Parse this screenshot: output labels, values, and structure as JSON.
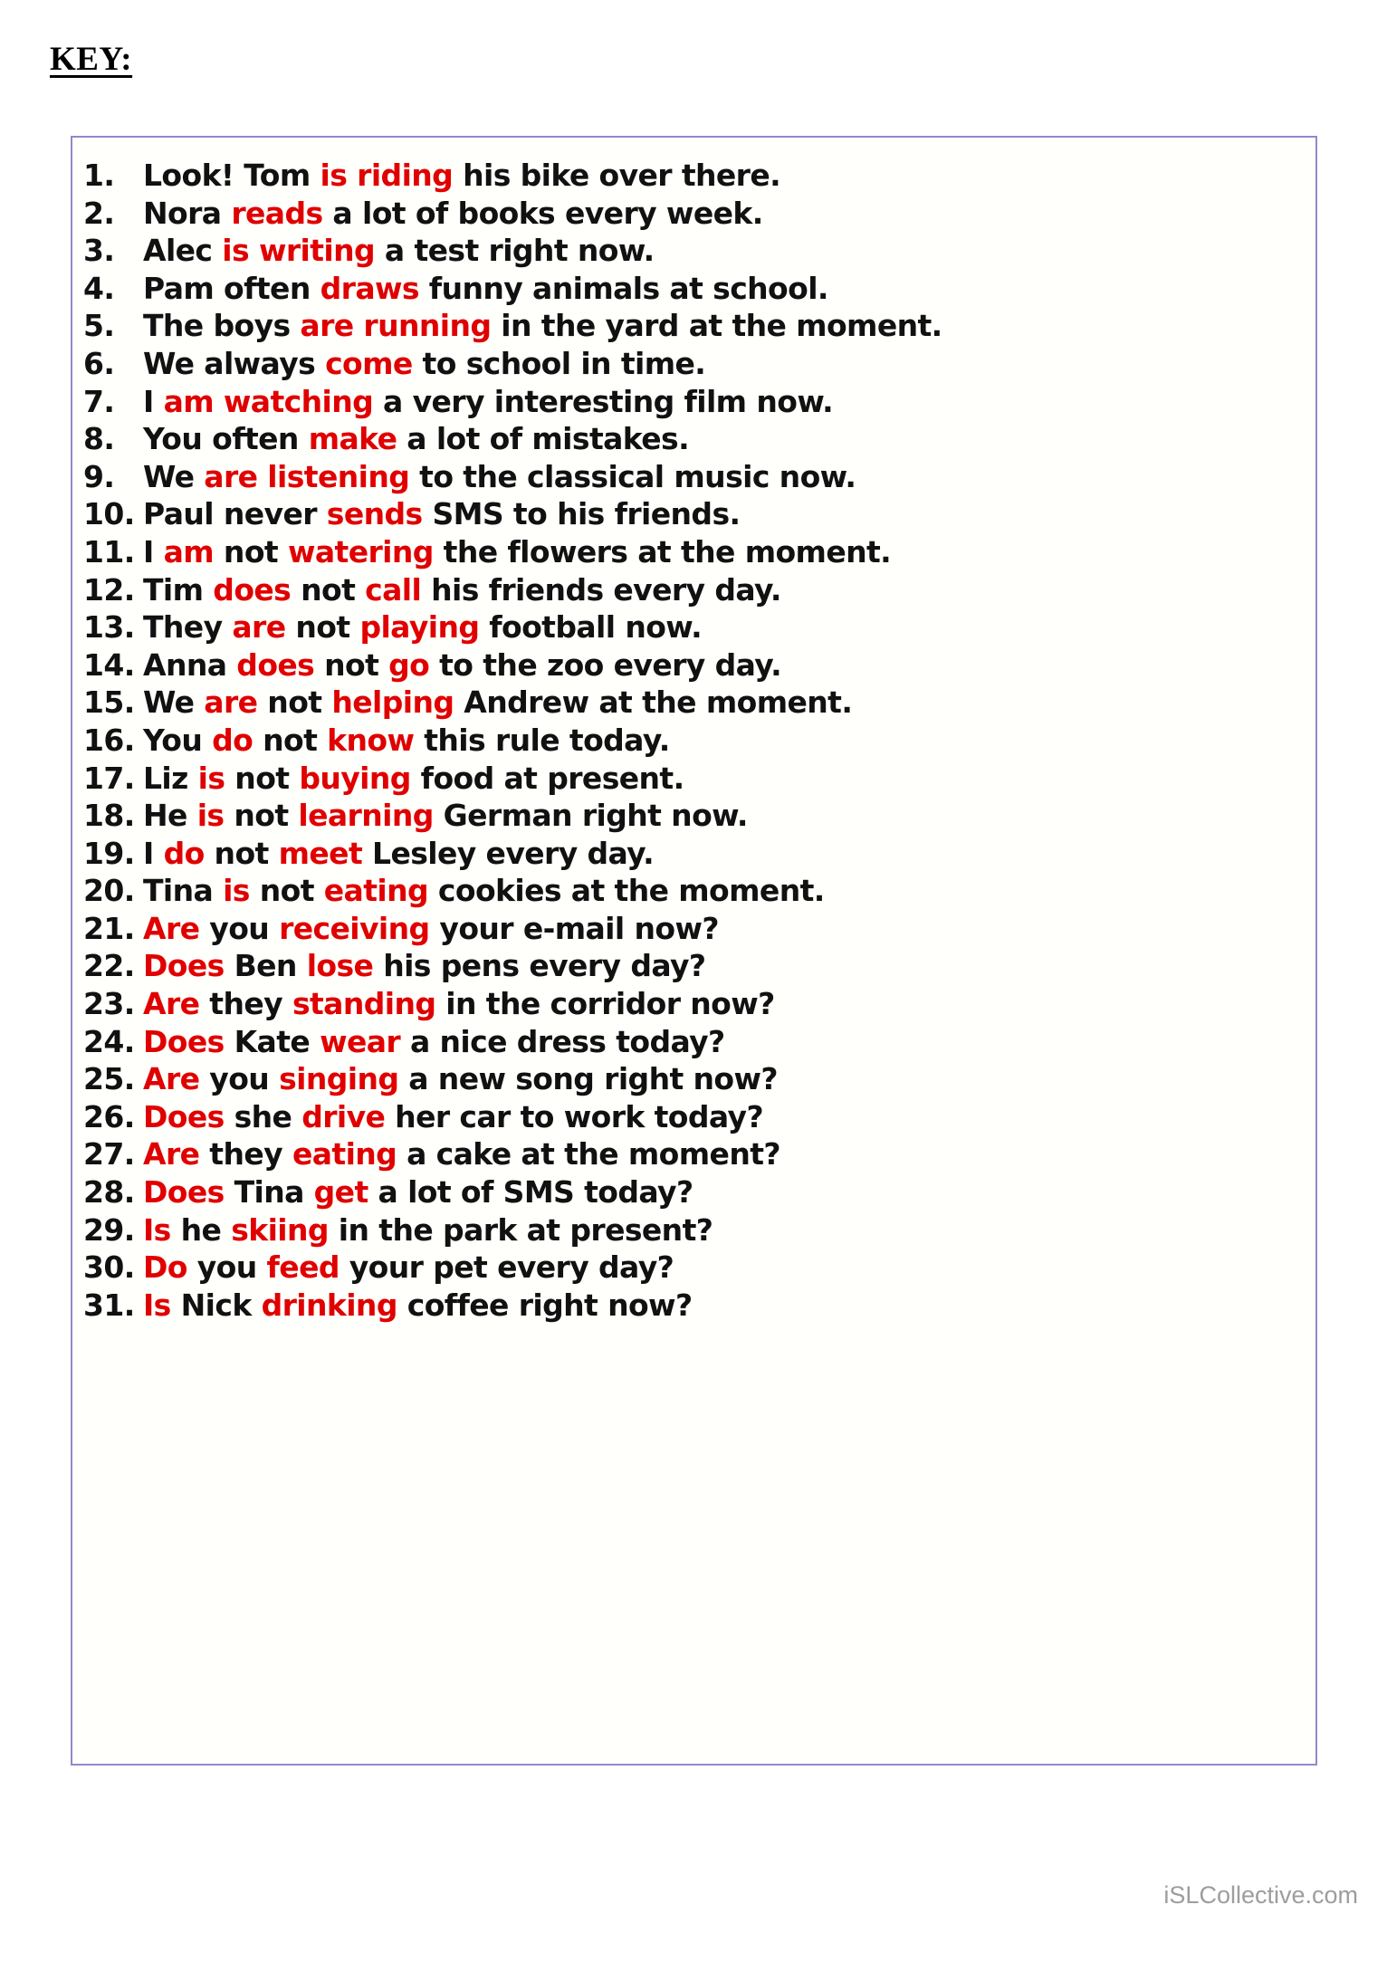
{
  "page": {
    "title": "KEY:",
    "background_color": "#ffffff",
    "box_border_color": "#8f8ac9",
    "highlight_color": "#e00000",
    "text_color": "#111111"
  },
  "watermark": {
    "text": "iSLCollective.com",
    "color": "#9d9d9d"
  },
  "answers": [
    {
      "number": "1.",
      "segments": [
        {
          "t": "Look! Tom ",
          "hl": false
        },
        {
          "t": "is riding",
          "hl": true
        },
        {
          "t": " his bike over there.",
          "hl": false
        }
      ]
    },
    {
      "number": "2.",
      "segments": [
        {
          "t": "Nora ",
          "hl": false
        },
        {
          "t": "reads",
          "hl": true
        },
        {
          "t": " a lot of books every week.",
          "hl": false
        }
      ]
    },
    {
      "number": "3.",
      "segments": [
        {
          "t": "Alec ",
          "hl": false
        },
        {
          "t": "is writing",
          "hl": true
        },
        {
          "t": " a test right now.",
          "hl": false
        }
      ]
    },
    {
      "number": "4.",
      "segments": [
        {
          "t": "Pam often ",
          "hl": false
        },
        {
          "t": "draws",
          "hl": true
        },
        {
          "t": " funny animals at school.",
          "hl": false
        }
      ]
    },
    {
      "number": "5.",
      "segments": [
        {
          "t": "The boys ",
          "hl": false
        },
        {
          "t": "are running",
          "hl": true
        },
        {
          "t": " in the yard at the moment.",
          "hl": false
        }
      ]
    },
    {
      "number": "6.",
      "segments": [
        {
          "t": "We always ",
          "hl": false
        },
        {
          "t": "come",
          "hl": true
        },
        {
          "t": " to school in time.",
          "hl": false
        }
      ]
    },
    {
      "number": "7.",
      "segments": [
        {
          "t": "I ",
          "hl": false
        },
        {
          "t": "am watching",
          "hl": true
        },
        {
          "t": " a very interesting film now.",
          "hl": false
        }
      ]
    },
    {
      "number": "8.",
      "segments": [
        {
          "t": "You often ",
          "hl": false
        },
        {
          "t": "make",
          "hl": true
        },
        {
          "t": " a lot of mistakes.",
          "hl": false
        }
      ]
    },
    {
      "number": "9.",
      "segments": [
        {
          "t": "We ",
          "hl": false
        },
        {
          "t": "are listening",
          "hl": true
        },
        {
          "t": " to the classical music now.",
          "hl": false
        }
      ]
    },
    {
      "number": "10.",
      "segments": [
        {
          "t": "Paul never ",
          "hl": false
        },
        {
          "t": "sends",
          "hl": true
        },
        {
          "t": " SMS to his friends.",
          "hl": false
        }
      ]
    },
    {
      "number": "11.",
      "segments": [
        {
          "t": "I ",
          "hl": false
        },
        {
          "t": "am",
          "hl": true
        },
        {
          "t": " not ",
          "hl": false
        },
        {
          "t": "watering",
          "hl": true
        },
        {
          "t": " the flowers at the moment.",
          "hl": false
        }
      ]
    },
    {
      "number": "12.",
      "segments": [
        {
          "t": "Tim ",
          "hl": false
        },
        {
          "t": "does",
          "hl": true
        },
        {
          "t": " not ",
          "hl": false
        },
        {
          "t": "call",
          "hl": true
        },
        {
          "t": " his friends every day.",
          "hl": false
        }
      ]
    },
    {
      "number": "13.",
      "segments": [
        {
          "t": "They ",
          "hl": false
        },
        {
          "t": "are",
          "hl": true
        },
        {
          "t": " not ",
          "hl": false
        },
        {
          "t": "playing",
          "hl": true
        },
        {
          "t": " football now.",
          "hl": false
        }
      ]
    },
    {
      "number": "14.",
      "segments": [
        {
          "t": "Anna ",
          "hl": false
        },
        {
          "t": "does",
          "hl": true
        },
        {
          "t": " not ",
          "hl": false
        },
        {
          "t": "go",
          "hl": true
        },
        {
          "t": " to the zoo every day.",
          "hl": false
        }
      ]
    },
    {
      "number": "15.",
      "segments": [
        {
          "t": "We ",
          "hl": false
        },
        {
          "t": "are",
          "hl": true
        },
        {
          "t": " not ",
          "hl": false
        },
        {
          "t": "helping",
          "hl": true
        },
        {
          "t": " Andrew at the moment.",
          "hl": false
        }
      ]
    },
    {
      "number": "16.",
      "segments": [
        {
          "t": "You ",
          "hl": false
        },
        {
          "t": "do",
          "hl": true
        },
        {
          "t": " not ",
          "hl": false
        },
        {
          "t": "know",
          "hl": true
        },
        {
          "t": " this rule today.",
          "hl": false
        }
      ]
    },
    {
      "number": "17.",
      "segments": [
        {
          "t": "Liz ",
          "hl": false
        },
        {
          "t": "is",
          "hl": true
        },
        {
          "t": " not ",
          "hl": false
        },
        {
          "t": "buying",
          "hl": true
        },
        {
          "t": " food at present.",
          "hl": false
        }
      ]
    },
    {
      "number": "18.",
      "segments": [
        {
          "t": "He ",
          "hl": false
        },
        {
          "t": "is",
          "hl": true
        },
        {
          "t": " not ",
          "hl": false
        },
        {
          "t": "learning",
          "hl": true
        },
        {
          "t": " German right now.",
          "hl": false
        }
      ]
    },
    {
      "number": "19.",
      "segments": [
        {
          "t": "I ",
          "hl": false
        },
        {
          "t": "do",
          "hl": true
        },
        {
          "t": " not ",
          "hl": false
        },
        {
          "t": "meet",
          "hl": true
        },
        {
          "t": " Lesley every day.",
          "hl": false
        }
      ]
    },
    {
      "number": "20.",
      "segments": [
        {
          "t": "Tina ",
          "hl": false
        },
        {
          "t": "is",
          "hl": true
        },
        {
          "t": " not ",
          "hl": false
        },
        {
          "t": "eating",
          "hl": true
        },
        {
          "t": " cookies at the moment.",
          "hl": false
        }
      ]
    },
    {
      "number": "21.",
      "segments": [
        {
          "t": "Are",
          "hl": true
        },
        {
          "t": " you ",
          "hl": false
        },
        {
          "t": "receiving",
          "hl": true
        },
        {
          "t": " your e-mail now?",
          "hl": false
        }
      ]
    },
    {
      "number": "22.",
      "segments": [
        {
          "t": "Does",
          "hl": true
        },
        {
          "t": " Ben ",
          "hl": false
        },
        {
          "t": "lose",
          "hl": true
        },
        {
          "t": " his pens every day?",
          "hl": false
        }
      ]
    },
    {
      "number": "23.",
      "segments": [
        {
          "t": "Are",
          "hl": true
        },
        {
          "t": " they ",
          "hl": false
        },
        {
          "t": "standing",
          "hl": true
        },
        {
          "t": " in the corridor now?",
          "hl": false
        }
      ]
    },
    {
      "number": "24.",
      "segments": [
        {
          "t": "Does",
          "hl": true
        },
        {
          "t": " Kate ",
          "hl": false
        },
        {
          "t": "wear",
          "hl": true
        },
        {
          "t": " a nice dress today?",
          "hl": false
        }
      ]
    },
    {
      "number": "25.",
      "segments": [
        {
          "t": "Are",
          "hl": true
        },
        {
          "t": " you ",
          "hl": false
        },
        {
          "t": "singing",
          "hl": true
        },
        {
          "t": " a new song right now?",
          "hl": false
        }
      ]
    },
    {
      "number": "26.",
      "segments": [
        {
          "t": "Does",
          "hl": true
        },
        {
          "t": " she ",
          "hl": false
        },
        {
          "t": "drive",
          "hl": true
        },
        {
          "t": " her car to work today?",
          "hl": false
        }
      ]
    },
    {
      "number": "27.",
      "segments": [
        {
          "t": "Are",
          "hl": true
        },
        {
          "t": " they ",
          "hl": false
        },
        {
          "t": "eating",
          "hl": true
        },
        {
          "t": " a cake at the moment?",
          "hl": false
        }
      ]
    },
    {
      "number": "28.",
      "segments": [
        {
          "t": "Does",
          "hl": true
        },
        {
          "t": " Tina ",
          "hl": false
        },
        {
          "t": "get",
          "hl": true
        },
        {
          "t": " a lot of SMS today?",
          "hl": false
        }
      ]
    },
    {
      "number": "29.",
      "segments": [
        {
          "t": "Is",
          "hl": true
        },
        {
          "t": " he ",
          "hl": false
        },
        {
          "t": "skiing",
          "hl": true
        },
        {
          "t": " in the park at present?",
          "hl": false
        }
      ]
    },
    {
      "number": "30.",
      "segments": [
        {
          "t": "Do",
          "hl": true
        },
        {
          "t": " you ",
          "hl": false
        },
        {
          "t": "feed",
          "hl": true
        },
        {
          "t": " your pet every day?",
          "hl": false
        }
      ]
    },
    {
      "number": "31.",
      "segments": [
        {
          "t": "Is",
          "hl": true
        },
        {
          "t": " Nick ",
          "hl": false
        },
        {
          "t": "drinking",
          "hl": true
        },
        {
          "t": " coffee right now?",
          "hl": false
        }
      ]
    }
  ]
}
